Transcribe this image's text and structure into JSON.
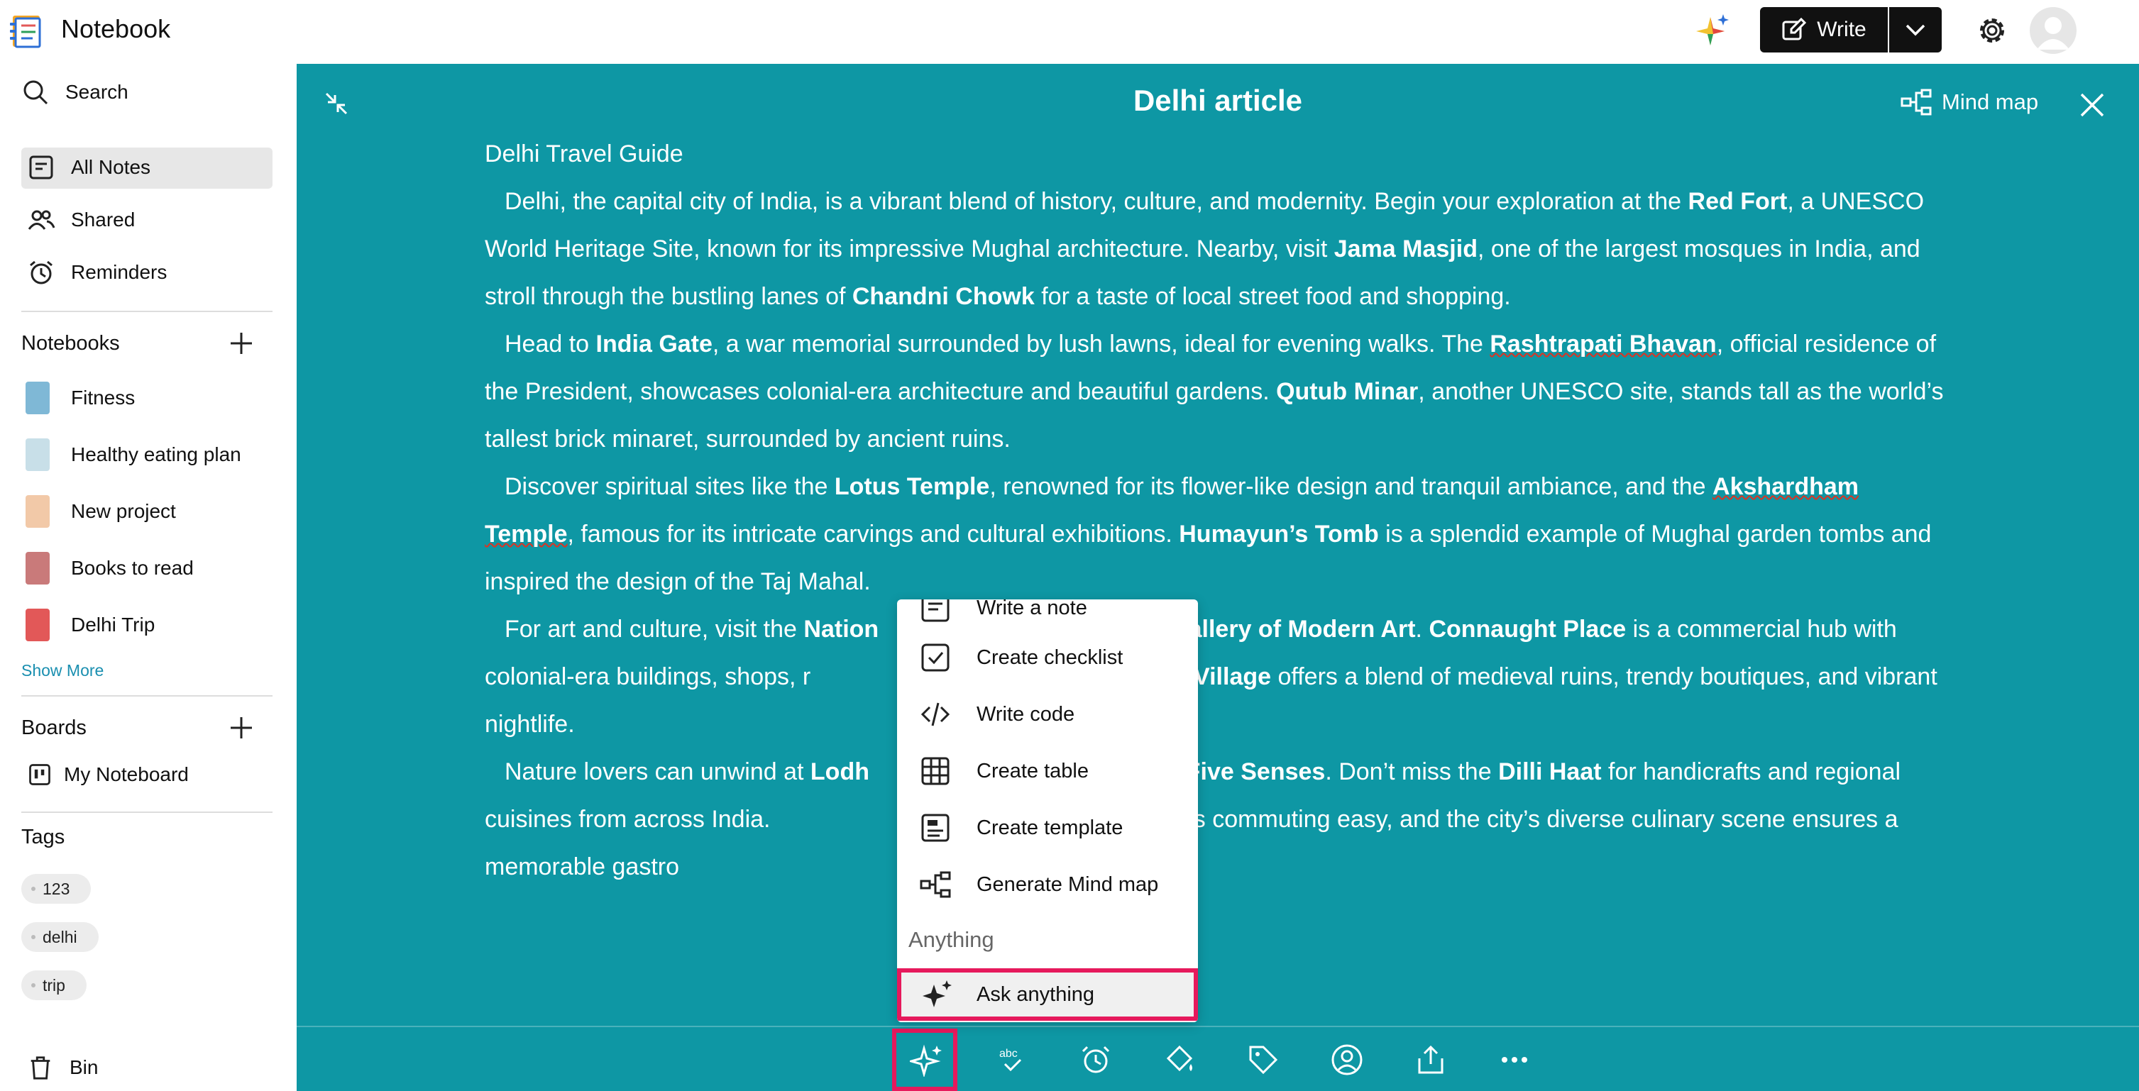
{
  "app": {
    "title": "Notebook"
  },
  "header": {
    "write_label": "Write"
  },
  "sidebar": {
    "search": "Search",
    "nav": [
      {
        "label": "All Notes",
        "icon": "notes-icon"
      },
      {
        "label": "Shared",
        "icon": "users-icon"
      },
      {
        "label": "Reminders",
        "icon": "alarm-icon"
      }
    ],
    "notebooks_heading": "Notebooks",
    "notebooks": [
      {
        "label": "Fitness",
        "color": "#7fb8d6"
      },
      {
        "label": "Healthy eating plan",
        "color": "#c8dfe8"
      },
      {
        "label": "New project",
        "color": "#f2c9a8"
      },
      {
        "label": "Books to read",
        "color": "#c97a7a"
      },
      {
        "label": "Delhi Trip",
        "color": "#e25858"
      }
    ],
    "show_more": "Show More",
    "boards_heading": "Boards",
    "boards": [
      {
        "label": "My Noteboard"
      }
    ],
    "tags_heading": "Tags",
    "tags": [
      "123",
      "delhi",
      "trip"
    ],
    "bin": "Bin"
  },
  "note": {
    "title": "Delhi article",
    "mind_map_label": "Mind map",
    "heading": "Delhi Travel Guide",
    "p1": [
      "Delhi, the capital city of India, is a vibrant blend of history, culture, and modernity. Begin your exploration at the ",
      "Red Fort",
      ", a UNESCO World Heritage Site, known for its impressive Mughal architecture. Nearby, visit ",
      "Jama Masjid",
      ", one of the largest mosques in India, and stroll through the bustling lanes of ",
      "Chandni Chowk",
      " for a taste of local street food and shopping."
    ],
    "p2": [
      "Head to ",
      "India Gate",
      ", a war memorial surrounded by lush lawns, ideal for evening walks. The ",
      "Rashtrapati Bhavan",
      ", official residence of the President, showcases colonial-era architecture and beautiful gardens. ",
      "Qutub Minar",
      ", another UNESCO site, stands tall as the world’s tallest brick minaret, surrounded by ancient ruins."
    ],
    "p3": [
      "Discover spiritual sites like the ",
      "Lotus Temple",
      ", renowned for its flower-like design and tranquil ambiance, and the ",
      "Akshardham Temple",
      ", famous for its intricate carvings and cultural exhibitions. ",
      "Humayun’s Tomb",
      " is a splendid example of Mughal garden tombs and inspired the design of the Taj Mahal."
    ],
    "p4": [
      "For art and culture, visit the ",
      "Nation",
      "",
      "Gallery of Modern Art",
      ". ",
      "Connaught Place",
      " is a commercial hub with colonial-era buildings, shops, r",
      "",
      "",
      "uz Khas Village",
      " offers a blend of medieval ruins, trendy boutiques, and vibrant nightlife."
    ],
    "p5": [
      "Nature lovers can unwind at ",
      "Lodh",
      "",
      "f Five Senses",
      ". Don’t miss the ",
      "Dilli Haat",
      " for handicrafts and regional cuisines from across India.",
      "stem makes commuting easy, and the city’s diverse culinary scene ensures a memorable gastro"
    ]
  },
  "menu": {
    "items": [
      "Write a note",
      "Create checklist",
      "Write code",
      "Create table",
      "Create template",
      "Generate Mind map"
    ],
    "section": "Anything",
    "ask": "Ask anything"
  }
}
